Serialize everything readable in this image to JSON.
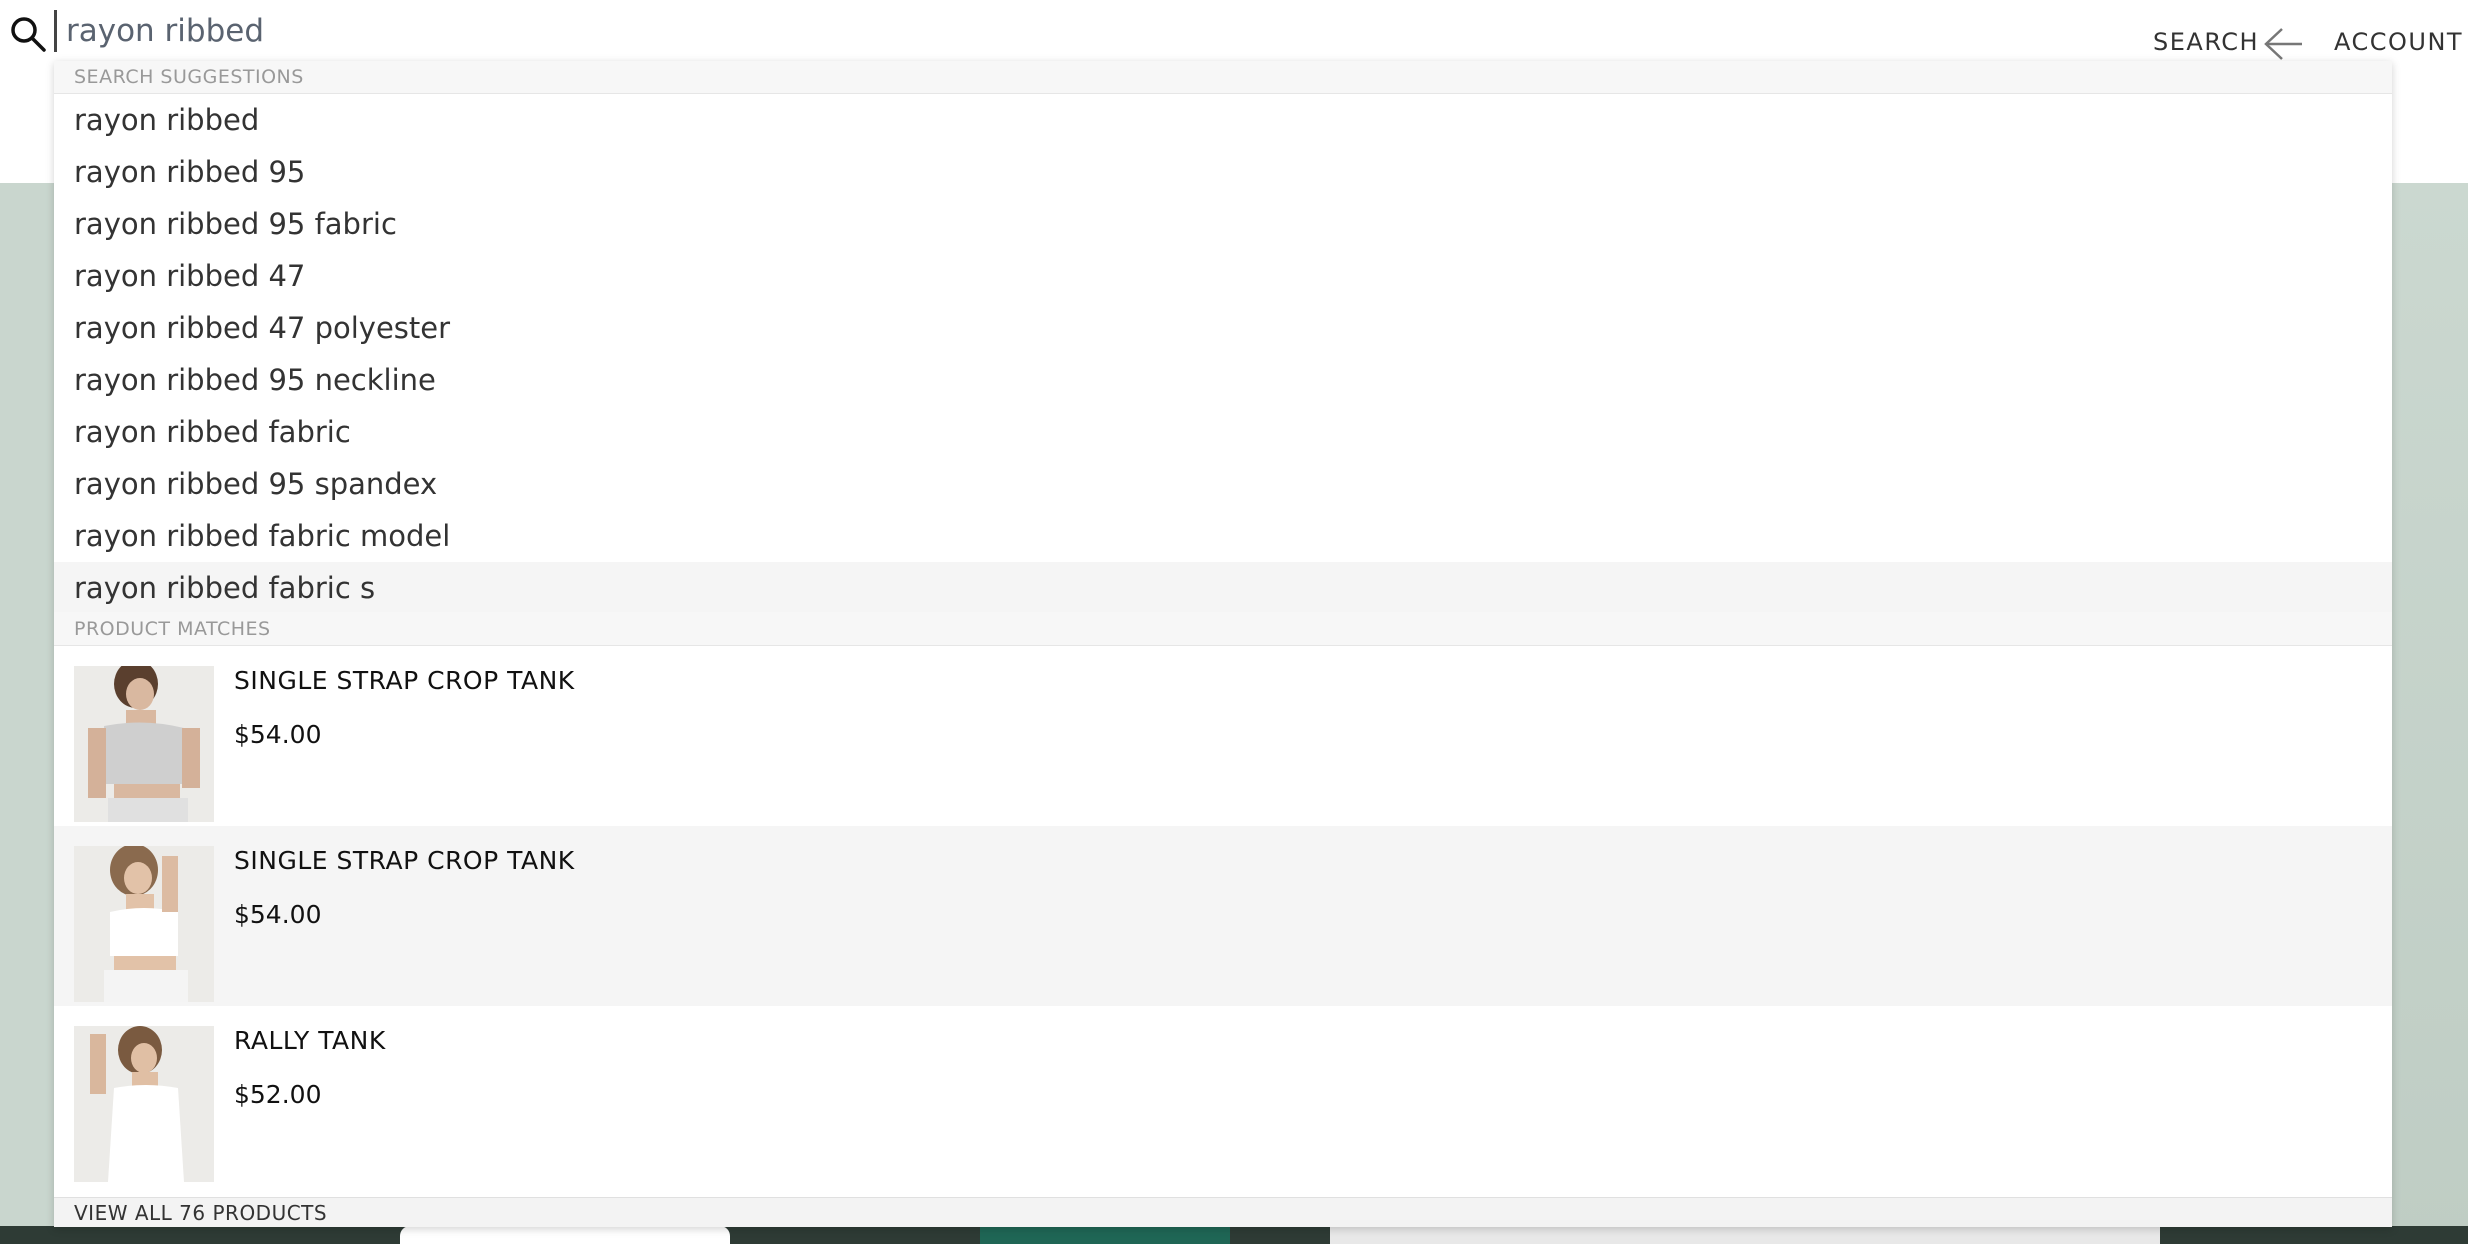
{
  "header": {
    "search_value": "rayon ribbed",
    "search_link": "SEARCH",
    "account_link": "ACCOUNT"
  },
  "dropdown": {
    "suggestions_heading": "SEARCH SUGGESTIONS",
    "suggestions": [
      "rayon ribbed",
      "rayon ribbed 95",
      "rayon ribbed 95 fabric",
      "rayon ribbed 47",
      "rayon ribbed 47 polyester",
      "rayon ribbed 95 neckline",
      "rayon ribbed fabric",
      "rayon ribbed 95 spandex",
      "rayon ribbed fabric model",
      "rayon ribbed fabric s"
    ],
    "products_heading": "PRODUCT MATCHES",
    "products": [
      {
        "name": "SINGLE STRAP CROP TANK",
        "price": "$54.00"
      },
      {
        "name": "SINGLE STRAP CROP TANK",
        "price": "$54.00"
      },
      {
        "name": "RALLY TANK",
        "price": "$52.00"
      }
    ],
    "view_all": "VIEW ALL 76 PRODUCTS"
  },
  "icons": {
    "search": "search-icon",
    "back": "arrow-left-icon"
  },
  "colors": {
    "hero_background": "#c9d6ce",
    "highlight_row": "#f5f5f5",
    "section_header": "#f7f7f7"
  }
}
